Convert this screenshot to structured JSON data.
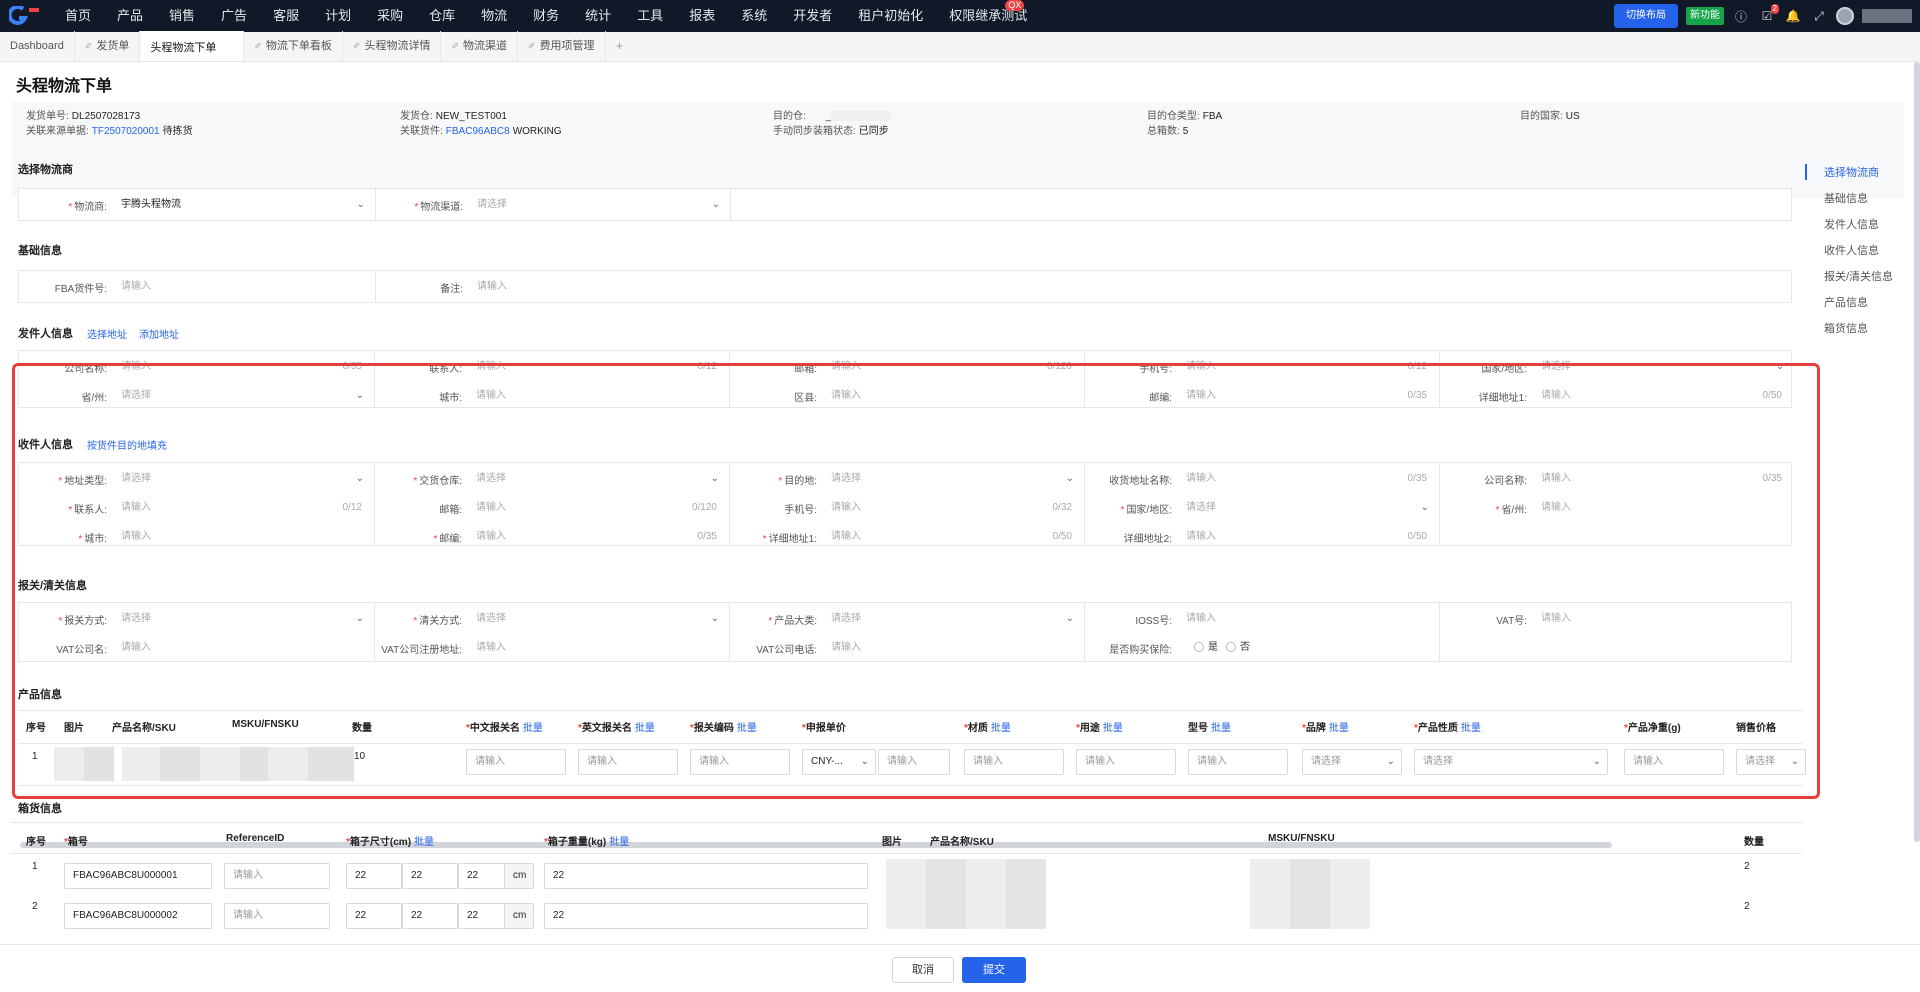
{
  "colors": {
    "accent": "#2563eb",
    "highlight_frame": "#e53e3e",
    "nav_bg": "#111827",
    "new_badge": "#16a34a"
  },
  "topnav": {
    "menu": [
      "首页",
      "产品",
      "销售",
      "广告",
      "客服",
      "计划",
      "采购",
      "仓库",
      "物流",
      "财务",
      "统计",
      "工具",
      "报表",
      "系统",
      "开发者",
      "租户初始化",
      "权限继承测试"
    ],
    "badge_label": "QX",
    "switch_layout": "切换布局",
    "new_feature": "新功能",
    "cart_count": "2",
    "icons": [
      "help-circle-icon",
      "task-icon",
      "bell-icon",
      "expand-icon"
    ]
  },
  "tabs": [
    {
      "label": "Dashboard"
    },
    {
      "label": "发货单"
    },
    {
      "label": "头程物流下单"
    },
    {
      "label": "物流下单看板"
    },
    {
      "label": "头程物流详情"
    },
    {
      "label": "物流渠道"
    },
    {
      "label": "费用项管理"
    },
    {
      "label": "+"
    }
  ],
  "page_title": "头程物流下单",
  "info": {
    "shipment_no_label": "发货单号:",
    "shipment_no": "DL2507028173",
    "source_label": "关联来源单据:",
    "source_value": "TF2507020001",
    "source_status": "待拣货",
    "warehouse_label": "发货仓:",
    "warehouse": "NEW_TEST001",
    "related_label": "关联货件:",
    "related_value": "FBAC96ABC8",
    "related_status": "WORKING",
    "dest_label": "目的仓:",
    "dest_value": "_",
    "sync_label": "手动同步装箱状态:",
    "sync_value": "已同步",
    "dest_type_label": "目的仓类型:",
    "dest_type": "FBA",
    "boxes_label": "总箱数:",
    "boxes": "5",
    "country_label": "目的国家:",
    "country": "US"
  },
  "sections": {
    "carrier": "选择物流商",
    "basic": "基础信息",
    "sender": "发件人信息",
    "sender_link1": "选择地址",
    "sender_link2": "添加地址",
    "receiver": "收件人信息",
    "receiver_link": "按货件目的地填充",
    "customs": "报关/清关信息",
    "product": "产品信息",
    "box": "箱货信息"
  },
  "carrier": {
    "carrier_label": "物流商:",
    "carrier_value": "宇腾头程物流",
    "channel_label": "物流渠道:",
    "channel_placeholder": "请选择"
  },
  "basic": {
    "fba_label": "FBA货件号:",
    "fba_ph": "请输入",
    "remark_label": "备注:",
    "remark_ph": "请输入"
  },
  "sender": {
    "company": "公司名称:",
    "company_cnt": "0/35",
    "contact": "联系人:",
    "contact_cnt": "0/12",
    "email": "邮箱:",
    "email_cnt": "0/120",
    "phone": "手机号:",
    "phone_cnt": "0/12",
    "country": "国家/地区:",
    "province": "省/州:",
    "city": "城市:",
    "district": "区县:",
    "zip": "邮编:",
    "zip_cnt": "0/35",
    "address1": "详细地址1:",
    "address1_cnt": "0/50"
  },
  "receiver": {
    "addr_type": "地址类型:",
    "warehouse": "交货仓库:",
    "dest": "目的地:",
    "recv_name": "收货地址名称:",
    "recv_name_cnt": "0/35",
    "company": "公司名称:",
    "company_cnt": "0/35",
    "contact": "联系人:",
    "contact_cnt": "0/12",
    "email": "邮箱:",
    "email_cnt": "0/120",
    "phone": "手机号:",
    "phone_cnt": "0/32",
    "country": "国家/地区:",
    "province": "省/州:",
    "city": "城市:",
    "zip": "邮编:",
    "zip_cnt": "0/35",
    "address1": "详细地址1:",
    "address1_cnt": "0/50",
    "address2": "详细地址2:",
    "address2_cnt": "0/50"
  },
  "customs": {
    "declare": "报关方式:",
    "clear": "清关方式:",
    "category": "产品大类:",
    "ioss": "IOSS号:",
    "vat": "VAT号:",
    "vat_company": "VAT公司名:",
    "vat_addr": "VAT公司注册地址:",
    "vat_phone": "VAT公司电话:",
    "insurance": "是否购买保险:",
    "yes": "是",
    "no": "否"
  },
  "placeholders": {
    "input": "请输入",
    "select": "请选择"
  },
  "product_table": {
    "headers": {
      "seq": "序号",
      "img": "图片",
      "name": "产品名称/SKU",
      "msku": "MSKU/FNSKU",
      "qty": "数量",
      "cn": "中文报关名",
      "en": "英文报关名",
      "hs": "报关编码",
      "price": "申报单价",
      "material": "材质",
      "usage": "用途",
      "model": "型号",
      "brand": "品牌",
      "nature": "产品性质",
      "weight": "产品净重(g)",
      "sale": "销售价格"
    },
    "batch": "批量",
    "row": {
      "seq": "1",
      "qty": "10",
      "currency": "CNY-..."
    }
  },
  "box_table": {
    "headers": {
      "seq": "序号",
      "box": "箱号",
      "ref": "ReferenceID",
      "size": "箱子尺寸(cm)",
      "weight": "箱子重量(kg)",
      "img": "图片",
      "name": "产品名称/SKU",
      "msku": "MSKU/FNSKU",
      "qty": "数量"
    },
    "batch": "批量",
    "unit": "cm",
    "rows": [
      {
        "seq": "1",
        "box": "FBAC96ABC8U000001",
        "l": "22",
        "w": "22",
        "h": "22",
        "weight": "22",
        "qty": "2"
      },
      {
        "seq": "2",
        "box": "FBAC96ABC8U000002",
        "l": "22",
        "w": "22",
        "h": "22",
        "weight": "22",
        "qty": "2"
      }
    ]
  },
  "right_nav": [
    "选择物流商",
    "基础信息",
    "发件人信息",
    "收件人信息",
    "报关/清关信息",
    "产品信息",
    "箱货信息"
  ],
  "footer": {
    "cancel": "取消",
    "submit": "提交"
  }
}
